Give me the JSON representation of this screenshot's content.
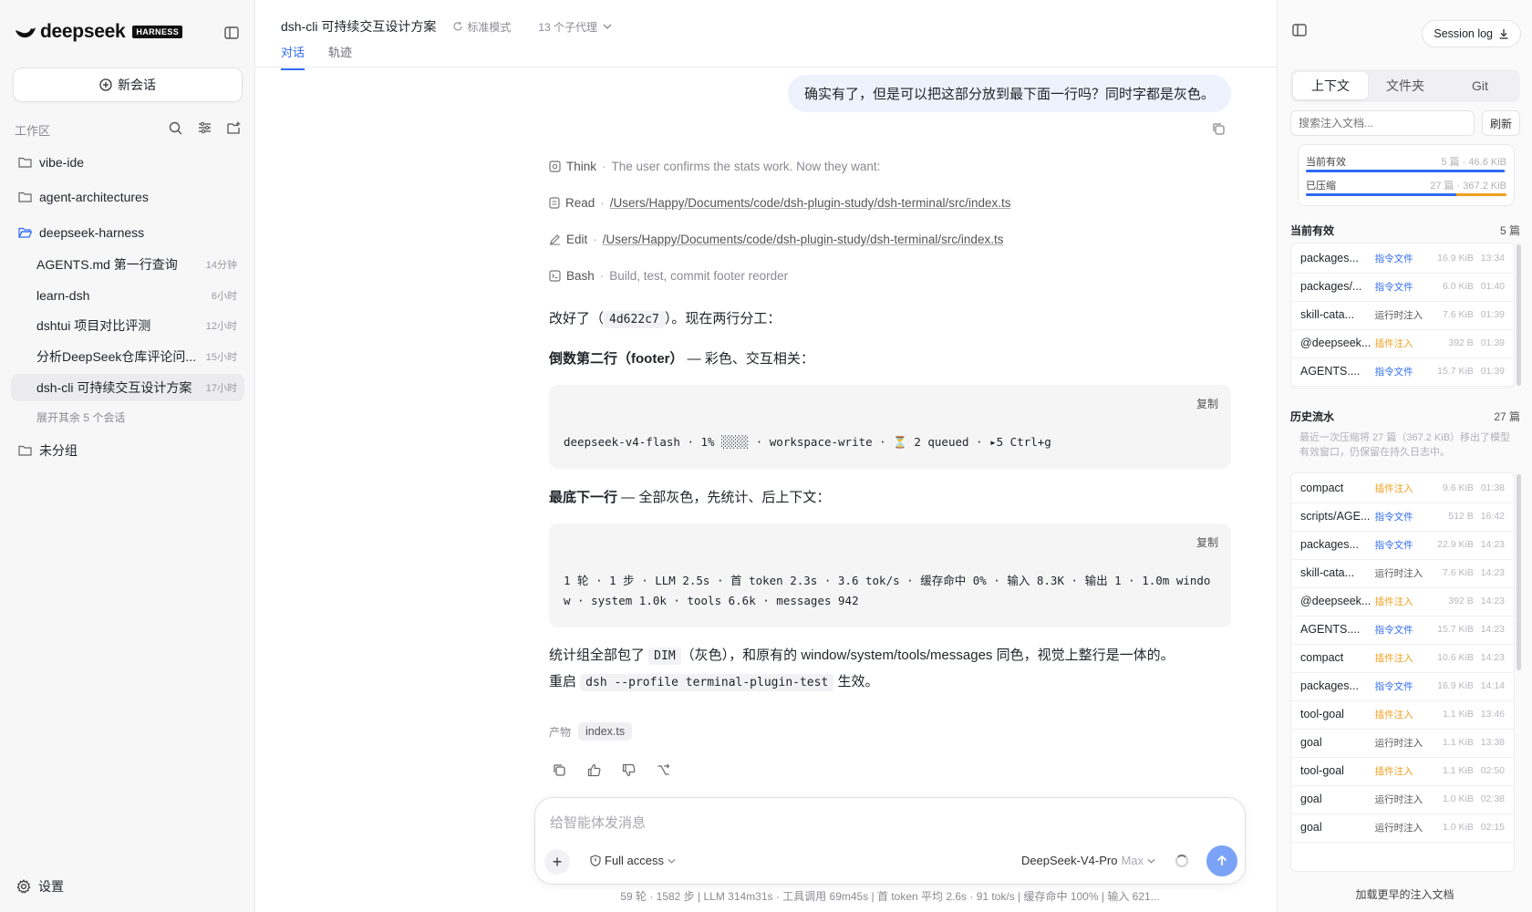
{
  "colors": {
    "accent": "#2f6bf0",
    "tag_command": "#2f6bf0",
    "tag_runtime": "#555555",
    "tag_plugin": "#f0a020",
    "meter_current": "#2f6bf0",
    "meter_compressed": "#f0a020"
  },
  "sidebar": {
    "brand": "deepseek",
    "badge": "HARNESS",
    "new_chat": "新会话",
    "workspace_label": "工作区",
    "folders": [
      {
        "name": "vibe-ide",
        "icon": "folder-icon"
      },
      {
        "name": "agent-architectures",
        "icon": "folder-icon"
      },
      {
        "name": "deepseek-harness",
        "icon": "folder-open-icon"
      }
    ],
    "sessions": [
      {
        "title": "AGENTS.md 第一行查询",
        "time": "14分钟"
      },
      {
        "title": "learn-dsh",
        "time": "6小时"
      },
      {
        "title": "dshtui 项目对比评测",
        "time": "12小时"
      },
      {
        "title": "分析DeepSeek仓库评论问...",
        "time": "15小时"
      },
      {
        "title": "dsh-cli 可持续交互设计方案",
        "time": "17小时"
      }
    ],
    "expand_more": "展开其余 5 个会话",
    "ungrouped": "未分组",
    "settings": "设置"
  },
  "main": {
    "title": "dsh-cli 可持续交互设计方案",
    "mode": "标准模式",
    "agents": "13 个子代理",
    "tabs": [
      "对话",
      "轨迹"
    ],
    "user_message": "确实有了，但是可以把这部分放到最下面一行吗？同时字都是灰色。",
    "steps": [
      {
        "name": "Think",
        "detail": "The user confirms the stats work. Now they want:",
        "link": false
      },
      {
        "name": "Read",
        "detail": "/Users/Happy/Documents/code/dsh-plugin-study/dsh-terminal/src/index.ts",
        "link": true
      },
      {
        "name": "Edit",
        "detail": "/Users/Happy/Documents/code/dsh-plugin-study/dsh-terminal/src/index.ts",
        "link": true
      },
      {
        "name": "Bash",
        "detail": "Build, test, commit footer reorder",
        "link": false
      }
    ],
    "p1_pre": "改好了（",
    "p1_code": "4d622c7",
    "p1_post": "）。现在两行分工：",
    "h1_strong": "倒数第二行（footer）",
    "h1_rest": " — 彩色、交互相关：",
    "copy_label": "复制",
    "code1": "deepseek-v4-flash · 1% ░░░░ · workspace-write · ⏳ 2 queued · ▸5 Ctrl+g",
    "h2_strong": "最底下一行",
    "h2_rest": " — 全部灰色，先统计、后上下文：",
    "code2": "1 轮 · 1 步 · LLM 2.5s · 首 token 2.3s · 3.6 tok/s · 缓存命中 0% · 输入 8.3K · 输出 1 · 1.0m window · system 1.0k · tools 6.6k · messages 942",
    "p3_a": "统计组全部包了 ",
    "p3_code": "DIM",
    "p3_b": "（灰色），和原有的 window/system/tools/messages 同色，视觉上整行是一体的。",
    "p4_a": "重启 ",
    "p4_code": "dsh --profile terminal-plugin-test",
    "p4_b": " 生效。",
    "artifacts_label": "产物",
    "artifact": "index.ts",
    "composer": {
      "placeholder": "给智能体发消息",
      "access": "Full access",
      "model": "DeepSeek-V4-Pro",
      "level": "Max"
    },
    "status_bar": "59 轮 · 1582 步  |  LLM 314m31s · 工具调用 69m45s  |  首 token 平均 2.6s · 91 tok/s  |  缓存命中 100%  |  输入 621..."
  },
  "right": {
    "session_log": "Session log",
    "tabs": [
      "上下文",
      "文件夹",
      "Git"
    ],
    "search_placeholder": "搜索注入文档...",
    "refresh": "刷新",
    "meter": {
      "current_label": "当前有效",
      "current_value": "5 篇 · 46.6 KiB",
      "current_fill": 0.99,
      "compressed_label": "已压缩",
      "compressed_value": "27 篇 · 367.2 KiB",
      "compressed_fill": 0.25
    },
    "current_header": "当前有效",
    "current_count": "5 篇",
    "current_items": [
      {
        "name": "packages...",
        "tag": "指令文件",
        "kind": "command",
        "size": "16.9 KiB",
        "time": "13:34"
      },
      {
        "name": "packages/...",
        "tag": "指令文件",
        "kind": "command",
        "size": "6.0 KiB",
        "time": "01:40"
      },
      {
        "name": "skill-cata...",
        "tag": "运行时注入",
        "kind": "runtime",
        "size": "7.6 KiB",
        "time": "01:39"
      },
      {
        "name": "@deepseek...",
        "tag": "插件注入",
        "kind": "plugin",
        "size": "392 B",
        "time": "01:39"
      },
      {
        "name": "AGENTS....",
        "tag": "指令文件",
        "kind": "command",
        "size": "15.7 KiB",
        "time": "01:39"
      }
    ],
    "history_header": "历史流水",
    "history_count": "27 篇",
    "history_note": "最近一次压缩将 27 篇（367.2 KiB）移出了模型有效窗口，仍保留在持久日志中。",
    "history_items": [
      {
        "name": "compact",
        "tag": "插件注入",
        "kind": "plugin",
        "size": "9.6 KiB",
        "time": "01:38"
      },
      {
        "name": "scripts/AGE...",
        "tag": "指令文件",
        "kind": "command",
        "size": "512 B",
        "time": "16:42"
      },
      {
        "name": "packages...",
        "tag": "指令文件",
        "kind": "command",
        "size": "22.9 KiB",
        "time": "14:23"
      },
      {
        "name": "skill-cata...",
        "tag": "运行时注入",
        "kind": "runtime",
        "size": "7.6 KiB",
        "time": "14:23"
      },
      {
        "name": "@deepseek...",
        "tag": "插件注入",
        "kind": "plugin",
        "size": "392 B",
        "time": "14:23"
      },
      {
        "name": "AGENTS....",
        "tag": "指令文件",
        "kind": "command",
        "size": "15.7 KiB",
        "time": "14:23"
      },
      {
        "name": "compact",
        "tag": "插件注入",
        "kind": "plugin",
        "size": "10.6 KiB",
        "time": "14:23"
      },
      {
        "name": "packages...",
        "tag": "指令文件",
        "kind": "command",
        "size": "16.9 KiB",
        "time": "14:14"
      },
      {
        "name": "tool-goal",
        "tag": "插件注入",
        "kind": "plugin",
        "size": "1.1 KiB",
        "time": "13:46"
      },
      {
        "name": "goal",
        "tag": "运行时注入",
        "kind": "runtime",
        "size": "1.1 KiB",
        "time": "13:38"
      },
      {
        "name": "tool-goal",
        "tag": "插件注入",
        "kind": "plugin",
        "size": "1.1 KiB",
        "time": "02:50"
      },
      {
        "name": "goal",
        "tag": "运行时注入",
        "kind": "runtime",
        "size": "1.0 KiB",
        "time": "02:38"
      },
      {
        "name": "goal",
        "tag": "运行时注入",
        "kind": "runtime",
        "size": "1.0 KiB",
        "time": "02:15"
      }
    ],
    "load_more": "加载更早的注入文档"
  }
}
